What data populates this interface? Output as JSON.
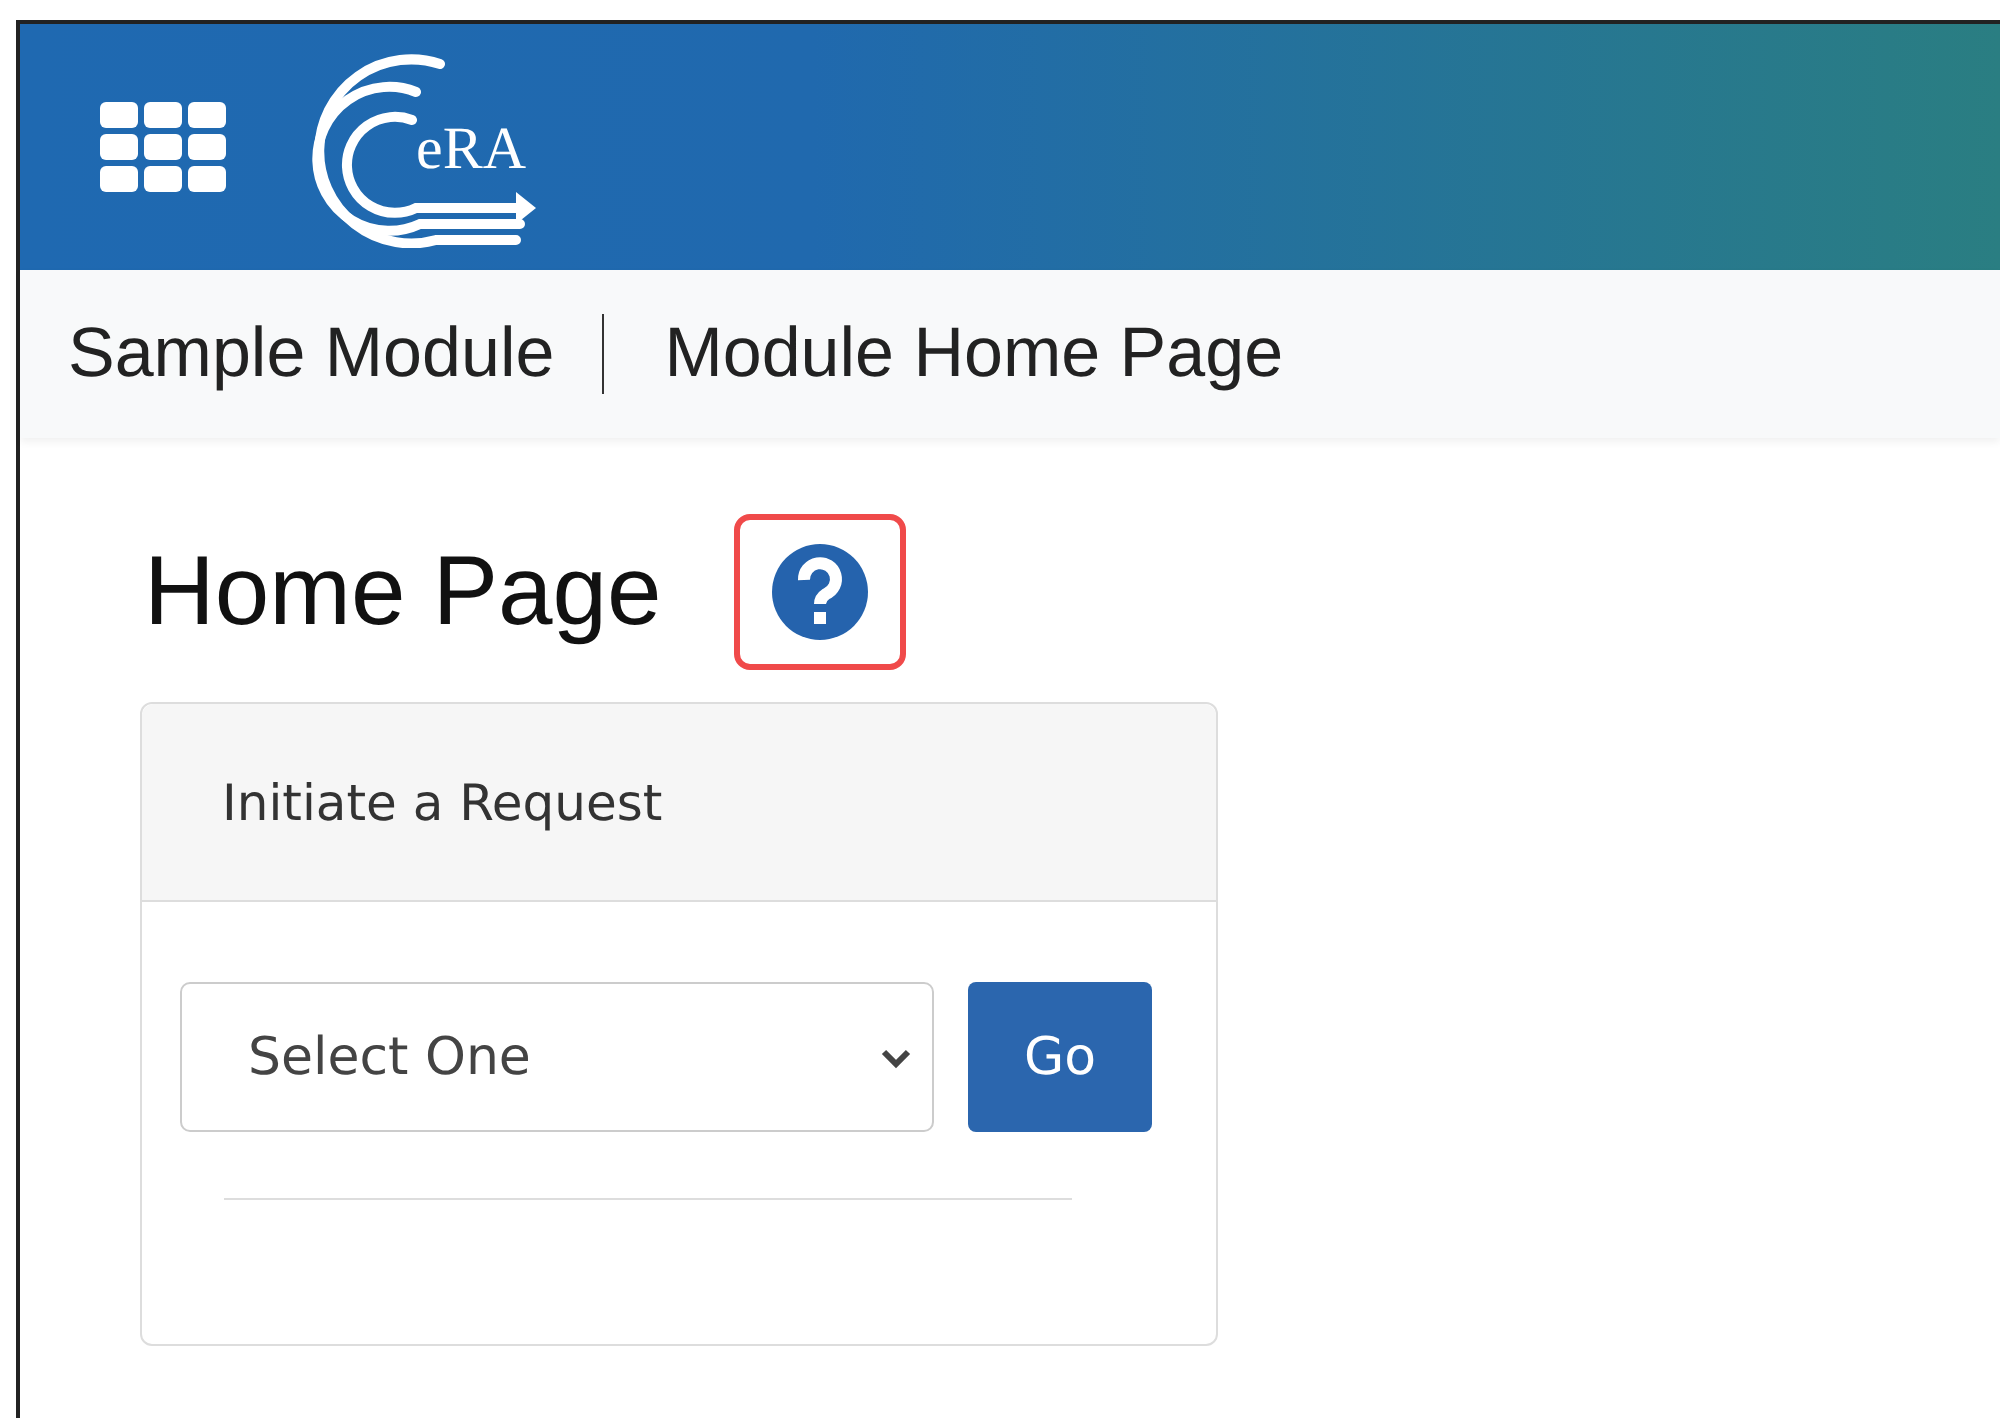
{
  "header": {
    "logo_text": "eRA"
  },
  "breadcrumb": [
    {
      "label": "Sample Module"
    },
    {
      "label": "Module Home Page"
    }
  ],
  "page": {
    "title": "Home Page",
    "help_highlighted": true
  },
  "card": {
    "title": "Initiate a Request",
    "select": {
      "value": "Select One"
    },
    "button": "Go"
  }
}
